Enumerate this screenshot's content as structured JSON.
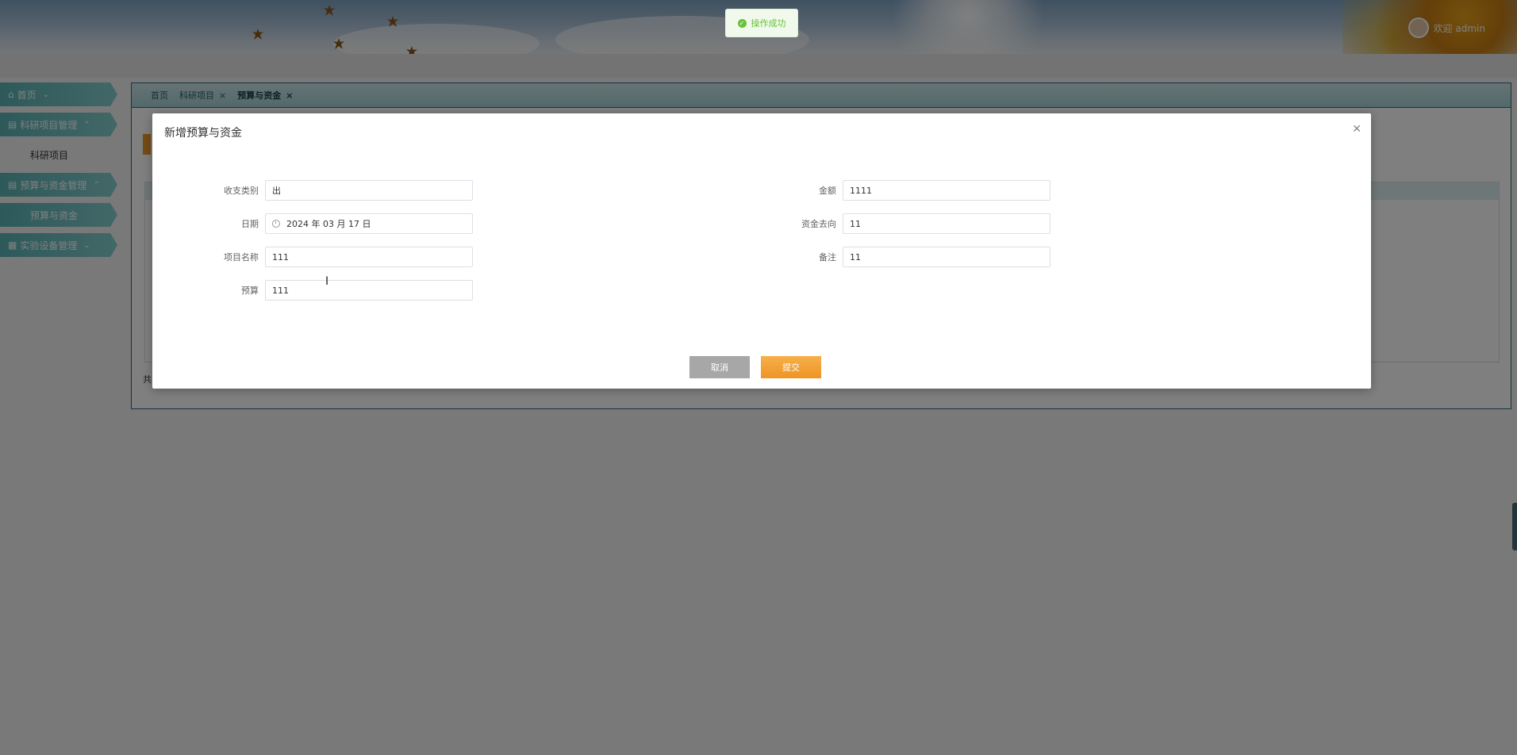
{
  "header": {
    "welcome": "欢迎 admin"
  },
  "sidebar": {
    "items": [
      {
        "label": "首页",
        "icon": "home-icon"
      },
      {
        "label": "科研项目管理",
        "icon": "table-icon",
        "children": [
          "科研项目"
        ]
      },
      {
        "label": "预算与资金管理",
        "icon": "table-icon",
        "children": [
          "预算与资金"
        ]
      },
      {
        "label": "实验设备管理",
        "icon": "device-icon"
      }
    ]
  },
  "tabs": [
    {
      "label": "首页"
    },
    {
      "label": "科研项目"
    },
    {
      "label": "预算与资金"
    }
  ],
  "list_footer": "共",
  "toast": {
    "message": "操作成功",
    "color": "#67c23a"
  },
  "modal": {
    "title": "新增预算与资金",
    "fields_left": [
      {
        "label": "收支类别",
        "value": "出"
      },
      {
        "label": "日期",
        "value": "2024 年 03 月 17 日"
      },
      {
        "label": "项目名称",
        "value": "111"
      },
      {
        "label": "预算",
        "value": "111"
      }
    ],
    "fields_right": [
      {
        "label": "金额",
        "value": "1111"
      },
      {
        "label": "资金去向",
        "value": "11"
      },
      {
        "label": "备注",
        "value": "11"
      }
    ],
    "cancel_label": "取消",
    "submit_label": "提交"
  },
  "colors": {
    "accent": "#ef9424",
    "sidebar": "#5bb3b5",
    "success": "#67c23a"
  }
}
